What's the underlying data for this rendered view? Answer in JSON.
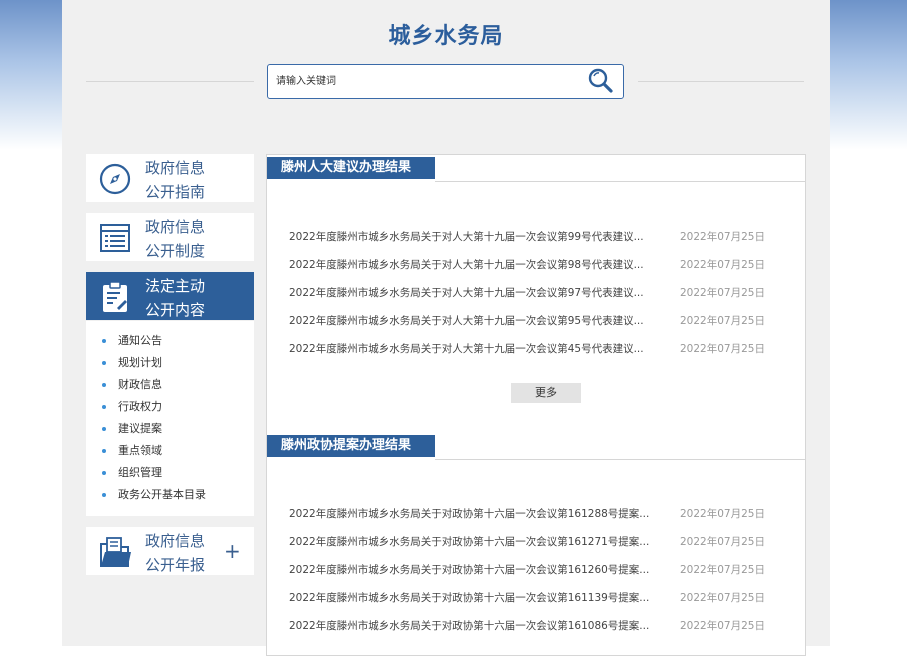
{
  "site": {
    "title": "城乡水务局"
  },
  "search": {
    "placeholder": "请输入关键词"
  },
  "sidebar": {
    "menu": [
      {
        "label_line1": "政府信息",
        "label_line2": "公开指南",
        "icon": "compass-icon"
      },
      {
        "label_line1": "政府信息",
        "label_line2": "公开制度",
        "icon": "list-document-icon"
      },
      {
        "label_line1": "法定主动",
        "label_line2": "公开内容",
        "icon": "clipboard-edit-icon"
      },
      {
        "label_line1": "政府信息",
        "label_line2": "公开年报",
        "icon": "folder-report-icon",
        "expand": "+"
      }
    ],
    "submenu": [
      "通知公告",
      "规划计划",
      "财政信息",
      "行政权力",
      "建议提案",
      "重点领域",
      "组织管理",
      "政务公开基本目录"
    ]
  },
  "sections": [
    {
      "title": "滕州人大建议办理结果",
      "items": [
        {
          "title": "2022年度滕州市城乡水务局关于对人大第十九届一次会议第99号代表建议...",
          "date": "2022年07月25日"
        },
        {
          "title": "2022年度滕州市城乡水务局关于对人大第十九届一次会议第98号代表建议...",
          "date": "2022年07月25日"
        },
        {
          "title": "2022年度滕州市城乡水务局关于对人大第十九届一次会议第97号代表建议...",
          "date": "2022年07月25日"
        },
        {
          "title": "2022年度滕州市城乡水务局关于对人大第十九届一次会议第95号代表建议...",
          "date": "2022年07月25日"
        },
        {
          "title": "2022年度滕州市城乡水务局关于对人大第十九届一次会议第45号代表建议...",
          "date": "2022年07月25日"
        }
      ],
      "more_label": "更多"
    },
    {
      "title": "滕州政协提案办理结果",
      "items": [
        {
          "title": "2022年度滕州市城乡水务局关于对政协第十六届一次会议第161288号提案...",
          "date": "2022年07月25日"
        },
        {
          "title": "2022年度滕州市城乡水务局关于对政协第十六届一次会议第161271号提案...",
          "date": "2022年07月25日"
        },
        {
          "title": "2022年度滕州市城乡水务局关于对政协第十六届一次会议第161260号提案...",
          "date": "2022年07月25日"
        },
        {
          "title": "2022年度滕州市城乡水务局关于对政协第十六届一次会议第161139号提案...",
          "date": "2022年07月25日"
        },
        {
          "title": "2022年度滕州市城乡水务局关于对政协第十六届一次会议第161086号提案...",
          "date": "2022年07月25日"
        }
      ]
    }
  ],
  "colors": {
    "brand": "#2d5f9a",
    "title": "#2c5e9c",
    "bullet": "#3a8fd6",
    "date": "#999999"
  }
}
